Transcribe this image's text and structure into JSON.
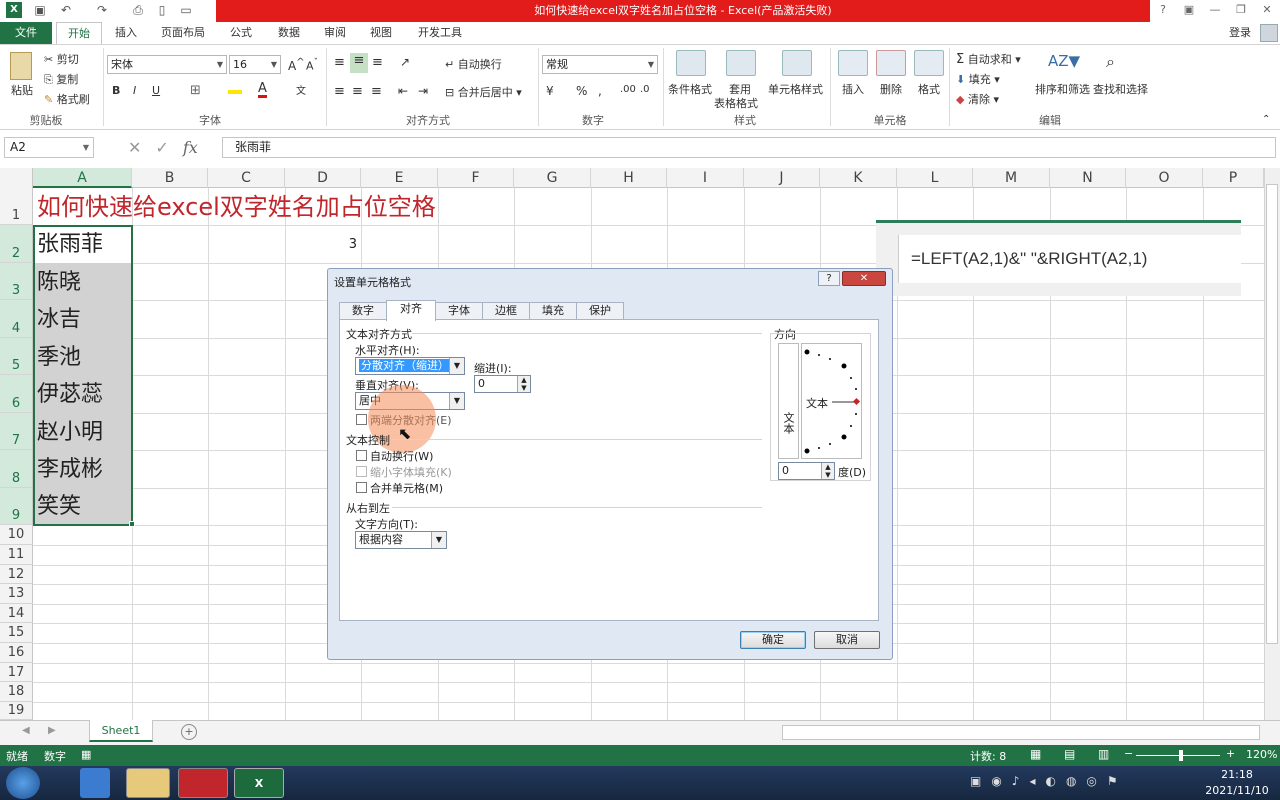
{
  "window": {
    "title": "如何快速给excel双字姓名加占位空格 - Excel(产品激活失败)",
    "controls": [
      "?",
      "▣",
      "—",
      "❐",
      "✕"
    ]
  },
  "tabs": [
    "文件",
    "开始",
    "插入",
    "页面布局",
    "公式",
    "数据",
    "审阅",
    "视图",
    "开发工具"
  ],
  "user": "登录",
  "ribbon": {
    "clipboard": {
      "paste": "粘贴",
      "cut": "剪切",
      "copy": "复制",
      "format_painter": "格式刷",
      "group": "剪贴板"
    },
    "font": {
      "name": "宋体",
      "size": "16",
      "group": "字体"
    },
    "alignment": {
      "wrap": "自动换行",
      "merge": "合并后居中",
      "group": "对齐方式"
    },
    "number": {
      "format": "常规",
      "group": "数字"
    },
    "styles": {
      "conditional": "条件格式",
      "table1": "套用",
      "table2": "表格格式",
      "cell_styles": "单元格样式",
      "group": "样式"
    },
    "cells": {
      "insert": "插入",
      "delete": "删除",
      "format": "格式",
      "group": "单元格"
    },
    "editing": {
      "autosum": "自动求和",
      "fill": "填充",
      "clear": "清除",
      "sort": "排序和筛选",
      "find": "查找和选择",
      "group": "编辑"
    }
  },
  "formula_bar": {
    "name_box": "A2",
    "formula": "张雨菲"
  },
  "columns": [
    "A",
    "B",
    "C",
    "D",
    "E",
    "F",
    "G",
    "H",
    "I",
    "J",
    "K",
    "L",
    "M",
    "N",
    "O",
    "P"
  ],
  "rows": [
    "1",
    "2",
    "3",
    "4",
    "5",
    "6",
    "7",
    "8",
    "9",
    "10",
    "11",
    "12",
    "13",
    "14",
    "15",
    "16",
    "17",
    "18",
    "19"
  ],
  "cells": {
    "A1": "如何快速给excel双字姓名加占位空格",
    "names": [
      "张雨菲",
      "陈晓",
      "冰吉",
      "季池",
      "伊苾蕊",
      "赵小明",
      "李成彬",
      "笑笑"
    ],
    "D2": "3"
  },
  "formula_image": "=LEFT(A2,1)&\"    \"&RIGHT(A2,1)",
  "dialog": {
    "title": "设置单元格格式",
    "tabs": [
      "数字",
      "对齐",
      "字体",
      "边框",
      "填充",
      "保护"
    ],
    "text_alignment": "文本对齐方式",
    "horizontal_label": "水平对齐(H):",
    "horizontal_value": "分散对齐（缩进）",
    "indent_label": "缩进(I):",
    "indent_value": "0",
    "vertical_label": "垂直对齐(V):",
    "vertical_value": "居中",
    "justify_distributed": "两端分散对齐(E)",
    "text_control": "文本控制",
    "wrap_text": "自动换行(W)",
    "shrink_to_fit": "缩小字体填充(K)",
    "merge_cells": "合并单元格(M)",
    "rtl": "从右到左",
    "text_direction_label": "文字方向(T):",
    "text_direction_value": "根据内容",
    "orientation": "方向",
    "vertical_text": "文本",
    "orient_text": "文本",
    "degrees_value": "0",
    "degrees_label": "度(D)",
    "ok": "确定",
    "cancel": "取消"
  },
  "sheet_tab": "Sheet1",
  "status": {
    "ready": "就绪",
    "mode": "数字",
    "count": "计数: 8",
    "zoom": "120%"
  },
  "taskbar": {
    "time": "21:18",
    "date": "2021/11/10"
  }
}
